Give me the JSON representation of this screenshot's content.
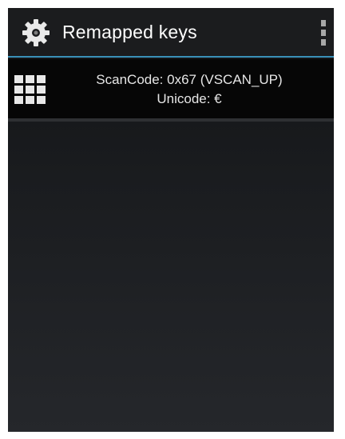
{
  "action_bar": {
    "title": "Remapped keys",
    "app_icon": "gear-icon",
    "menu_icon": "overflow-menu-icon"
  },
  "remapped_keys": [
    {
      "icon": "keypad-grid-icon",
      "scan_code_text": "ScanCode: 0x67 (VSCAN_UP)",
      "unicode_text": "Unicode: €"
    }
  ],
  "colors": {
    "accent": "#3a90b8",
    "background": "#1a1c1f",
    "text": "#e6e6e6"
  }
}
